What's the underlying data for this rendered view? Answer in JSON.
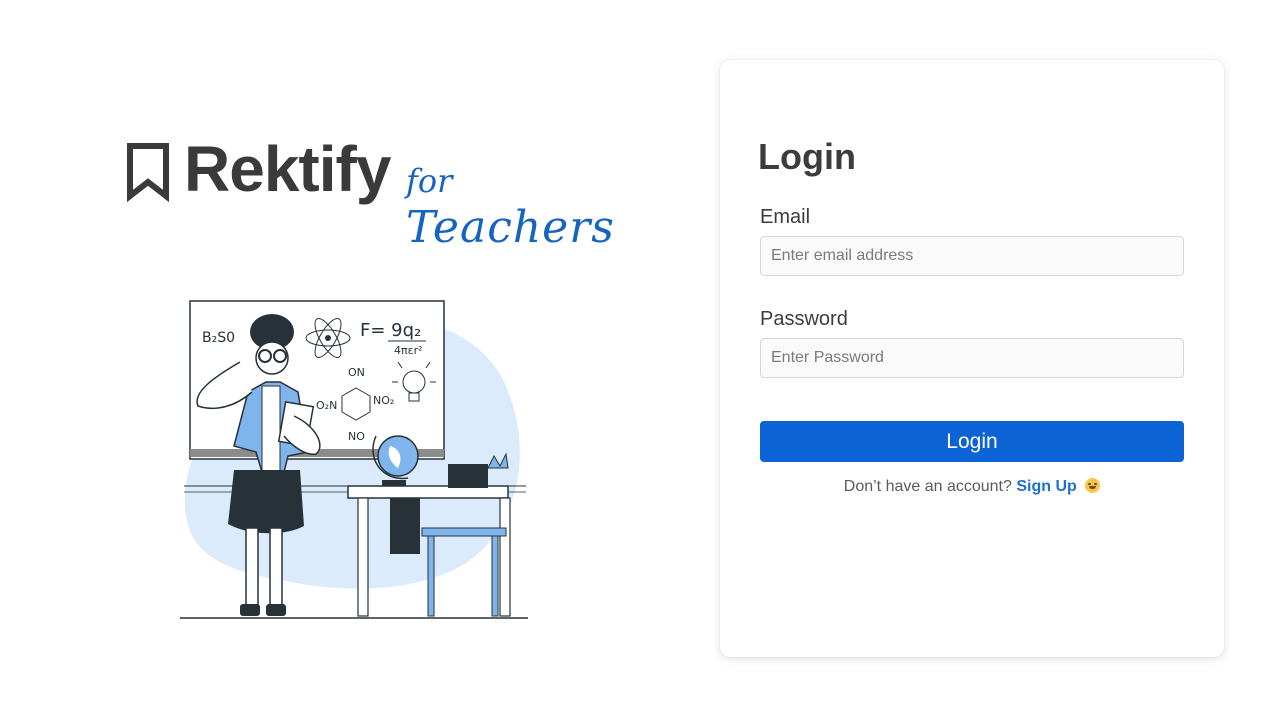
{
  "brand": {
    "name": "Rektify",
    "for_label": "for",
    "audience_label": "Teachers"
  },
  "illustration": {
    "chalk_formula_left": "B₂S0",
    "chalk_formula_main": "F= 9q₂",
    "chalk_formula_denominator": "4πεr²",
    "chalk_molecule_top": "ON",
    "chalk_molecule_left": "O₂N",
    "chalk_molecule_right": "NO₂",
    "chalk_molecule_bottom": "NO"
  },
  "login_card": {
    "title": "Login",
    "email": {
      "label": "Email",
      "placeholder": "Enter email address",
      "value": ""
    },
    "password": {
      "label": "Password",
      "placeholder": "Enter Password",
      "value": ""
    },
    "submit_label": "Login",
    "signup_prompt": "Don’t have an account?",
    "signup_link": "Sign Up"
  },
  "colors": {
    "accent": "#0b63d6",
    "brand_text": "#3a3a3a",
    "script_blue": "#1565c0",
    "illustration_blue": "#7fb4ec"
  },
  "icons": {
    "logo": "bookmark-icon",
    "signup_emoji": "grinning-face-icon"
  }
}
